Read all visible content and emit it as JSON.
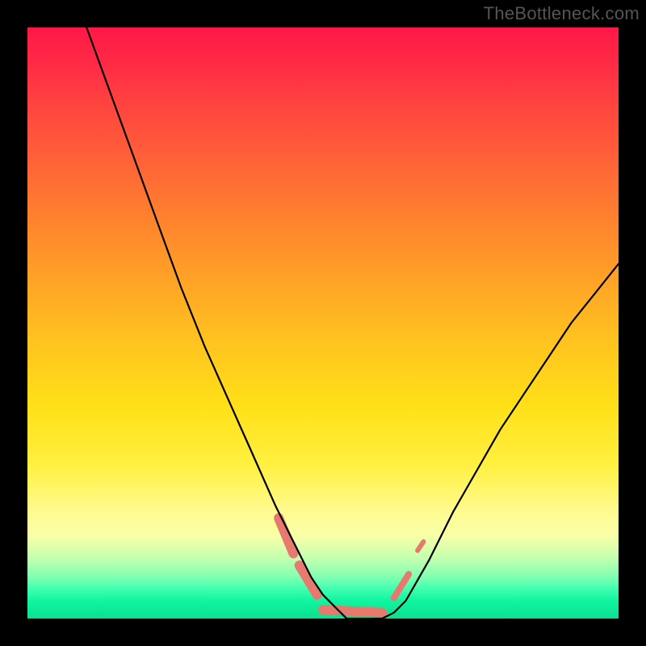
{
  "watermark": "TheBottleneck.com",
  "chart_data": {
    "type": "line",
    "title": "",
    "xlabel": "",
    "ylabel": "",
    "xlim": [
      0,
      100
    ],
    "ylim": [
      0,
      100
    ],
    "grid": false,
    "legend": false,
    "background_gradient_stops": [
      {
        "pos": 0,
        "color": "#ff1846"
      },
      {
        "pos": 6,
        "color": "#ff2a46"
      },
      {
        "pos": 12,
        "color": "#ff4040"
      },
      {
        "pos": 20,
        "color": "#ff5a3a"
      },
      {
        "pos": 30,
        "color": "#ff7a30"
      },
      {
        "pos": 40,
        "color": "#ff9a28"
      },
      {
        "pos": 52,
        "color": "#ffc020"
      },
      {
        "pos": 64,
        "color": "#ffe018"
      },
      {
        "pos": 74,
        "color": "#fff040"
      },
      {
        "pos": 82,
        "color": "#fffb90"
      },
      {
        "pos": 86,
        "color": "#f8ffa8"
      },
      {
        "pos": 90,
        "color": "#c0ffb0"
      },
      {
        "pos": 93,
        "color": "#80ffb0"
      },
      {
        "pos": 95,
        "color": "#40ffb0"
      },
      {
        "pos": 97,
        "color": "#10f5a0"
      },
      {
        "pos": 100,
        "color": "#0ce090"
      }
    ],
    "series": [
      {
        "name": "curve",
        "color": "#000000",
        "x": [
          10,
          14,
          18,
          22,
          26,
          30,
          34,
          38,
          42,
          44,
          46,
          48,
          50,
          52,
          54,
          56,
          58,
          60,
          62,
          64,
          68,
          72,
          76,
          80,
          84,
          88,
          92,
          96,
          100
        ],
        "y": [
          100,
          89,
          78,
          67,
          56,
          46,
          37,
          28,
          19,
          15,
          11,
          7,
          4,
          2,
          0,
          0,
          0,
          0,
          1,
          3,
          10,
          18,
          25,
          32,
          38,
          44,
          50,
          55,
          60
        ]
      }
    ],
    "highlight_segments": [
      {
        "name": "seg-a",
        "x": [
          42.5,
          45.0
        ],
        "y": [
          17.0,
          11.0
        ],
        "color": "#e77a6f",
        "width": 12
      },
      {
        "name": "seg-b",
        "x": [
          46.0,
          49.0
        ],
        "y": [
          9.0,
          4.0
        ],
        "color": "#e77a6f",
        "width": 12
      },
      {
        "name": "seg-c",
        "x": [
          50.0,
          60.0
        ],
        "y": [
          1.5,
          1.0
        ],
        "color": "#e77a6f",
        "width": 12
      },
      {
        "name": "seg-d",
        "x": [
          62.0,
          64.5
        ],
        "y": [
          3.5,
          7.5
        ],
        "color": "#e77a6f",
        "width": 8
      },
      {
        "name": "seg-e",
        "x": [
          66.0,
          67.0
        ],
        "y": [
          11.5,
          13.0
        ],
        "color": "#e77a6f",
        "width": 6
      }
    ]
  }
}
